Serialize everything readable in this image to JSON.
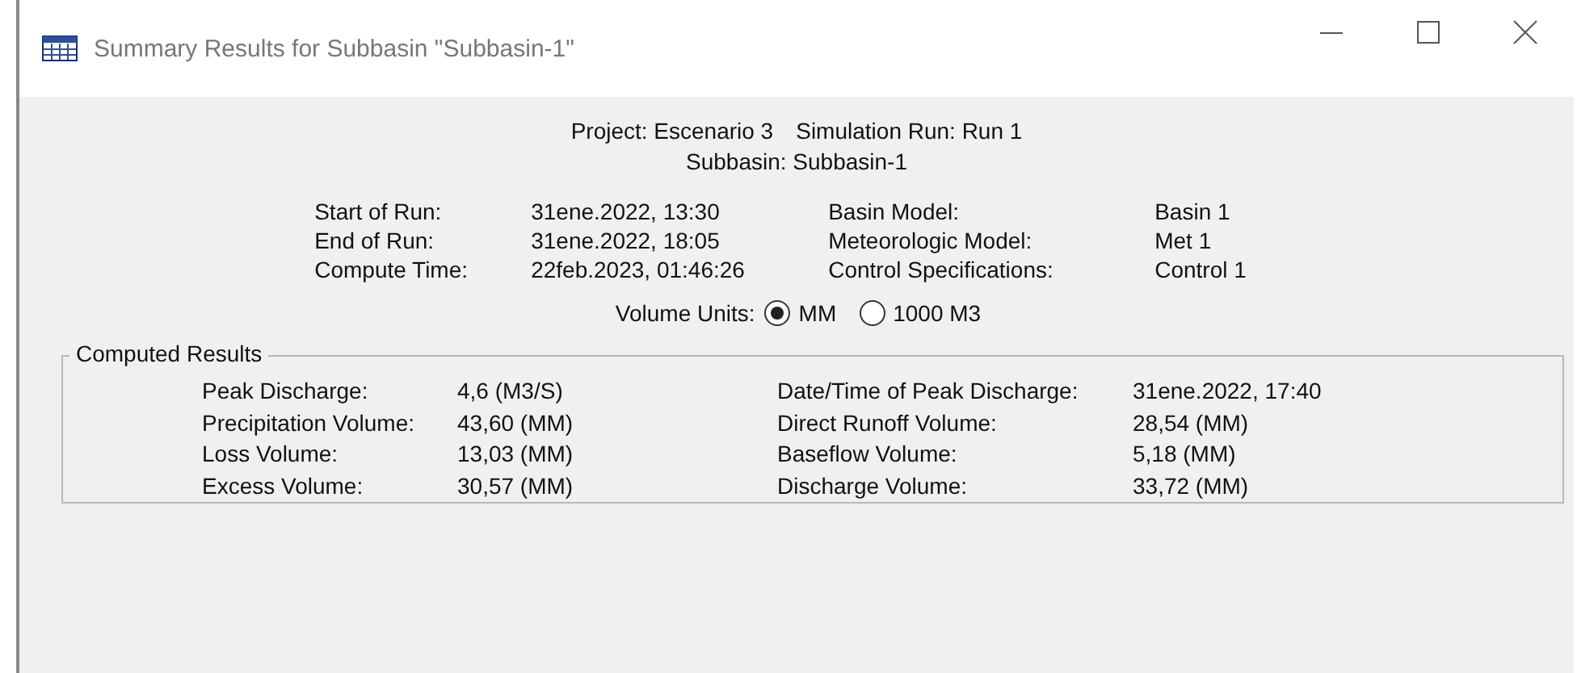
{
  "window": {
    "title": "Summary Results for Subbasin \"Subbasin-1\""
  },
  "header": {
    "lines": [
      [
        "Project: Escenario 3",
        "Simulation Run: Run 1"
      ],
      [
        "Subbasin: Subbasin-1"
      ]
    ]
  },
  "run_info": {
    "left": [
      {
        "label": "Start of Run:",
        "value": "31ene.2022, 13:30"
      },
      {
        "label": "End of Run:",
        "value": "31ene.2022, 18:05"
      },
      {
        "label": "Compute Time:",
        "value": "22feb.2023, 01:46:26"
      }
    ],
    "right": [
      {
        "label": "Basin Model:",
        "value": "Basin 1"
      },
      {
        "label": "Meteorologic Model:",
        "value": "Met 1"
      },
      {
        "label": "Control Specifications:",
        "value": "Control 1"
      }
    ]
  },
  "volume_units": {
    "label": "Volume Units:",
    "options": [
      {
        "label": "MM",
        "selected": true
      },
      {
        "label": "1000 M3",
        "selected": false
      }
    ]
  },
  "computed_results": {
    "title": "Computed Results",
    "left": [
      {
        "label": "Peak Discharge:",
        "value": "4,6 (M3/S)"
      },
      {
        "label": "Precipitation Volume:",
        "value": "43,60 (MM)"
      },
      {
        "label": "Loss Volume:",
        "value": "13,03 (MM)"
      },
      {
        "label": "Excess Volume:",
        "value": "30,57 (MM)"
      }
    ],
    "right": [
      {
        "label": "Date/Time of Peak Discharge:",
        "value": "31ene.2022, 17:40"
      },
      {
        "label": "Direct Runoff Volume:",
        "value": "28,54 (MM)"
      },
      {
        "label": "Baseflow Volume:",
        "value": "5,18 (MM)"
      },
      {
        "label": "Discharge Volume:",
        "value": "33,72 (MM)"
      }
    ]
  }
}
